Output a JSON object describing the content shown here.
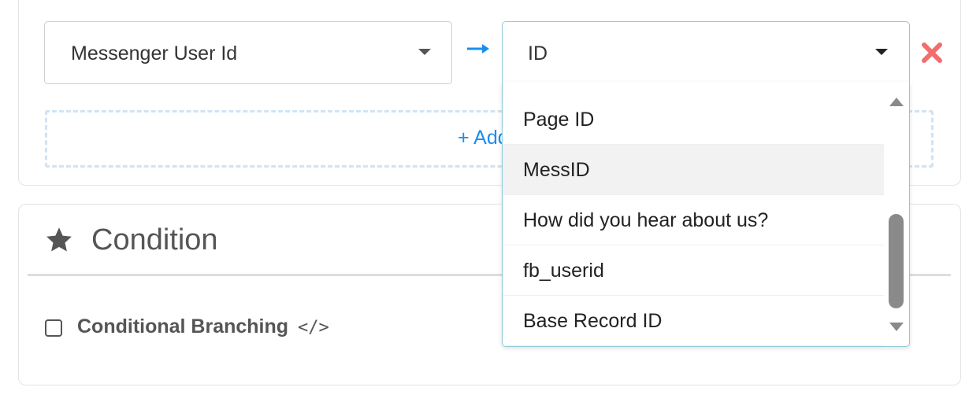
{
  "mapping": {
    "source_select_value": "Messenger User Id",
    "target_select_value": "ID",
    "add_button_label": "+ Add"
  },
  "dropdown": {
    "options": [
      "Page ID",
      "MessID",
      "How did you hear about us?",
      "fb_userid",
      "Base Record ID"
    ],
    "hovered_option": "MessID"
  },
  "condition": {
    "title": "Condition",
    "checkbox_label": "Conditional Branching",
    "code_glyph": "</>",
    "checked": false
  },
  "colors": {
    "arrow": "#1a8ef0",
    "remove": "#f26d6d",
    "add_text": "#1a8ef0",
    "focus_border": "#8ec9d6"
  },
  "icons": {
    "arrow": "arrow-right-icon",
    "remove": "close-icon",
    "star": "star-icon",
    "code": "code-icon"
  }
}
